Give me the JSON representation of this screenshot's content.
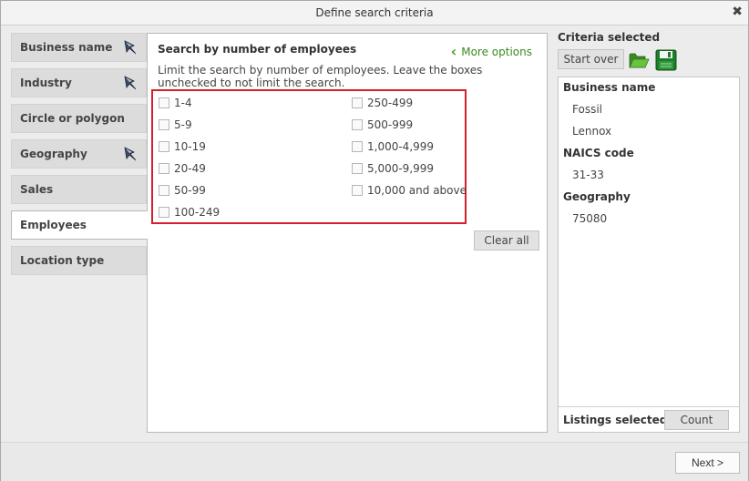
{
  "window": {
    "title": "Define search criteria",
    "close_glyph": "✖"
  },
  "nav": {
    "items": [
      {
        "label": "Business name",
        "has_pin": true,
        "active": false
      },
      {
        "label": "Industry",
        "has_pin": true,
        "active": false
      },
      {
        "label": "Circle or polygon",
        "has_pin": false,
        "active": false
      },
      {
        "label": "Geography",
        "has_pin": true,
        "active": false
      },
      {
        "label": "Sales",
        "has_pin": false,
        "active": false
      },
      {
        "label": "Employees",
        "has_pin": false,
        "active": true
      },
      {
        "label": "Location type",
        "has_pin": false,
        "active": false
      }
    ],
    "pin_icon": "pushpin-icon"
  },
  "main": {
    "title": "Search by number of employees",
    "more_options_label": "More options",
    "more_options_icon": "chevron-left-icon",
    "description": "Limit the search by number of employees. Leave the boxes unchecked to not limit the search.",
    "ranges_left": [
      "1-4",
      "5-9",
      "10-19",
      "20-49",
      "50-99",
      "100-249"
    ],
    "ranges_right": [
      "250-499",
      "500-999",
      "1,000-4,999",
      "5,000-9,999",
      "10,000 and above"
    ],
    "clear_all_label": "Clear all",
    "highlight_color": "#d51f2a"
  },
  "criteria": {
    "title": "Criteria selected",
    "start_over_label": "Start over",
    "open_icon": "folder-open-icon",
    "save_icon": "floppy-save-icon",
    "sections": [
      {
        "heading": "Business name",
        "values": [
          "Fossil",
          "Lennox"
        ]
      },
      {
        "heading": "NAICS code",
        "values": [
          "31-33"
        ]
      },
      {
        "heading": "Geography",
        "values": [
          "75080"
        ]
      }
    ],
    "listings_label": "Listings selected:",
    "count_label": "Count"
  },
  "footer": {
    "next_label": "Next >"
  }
}
